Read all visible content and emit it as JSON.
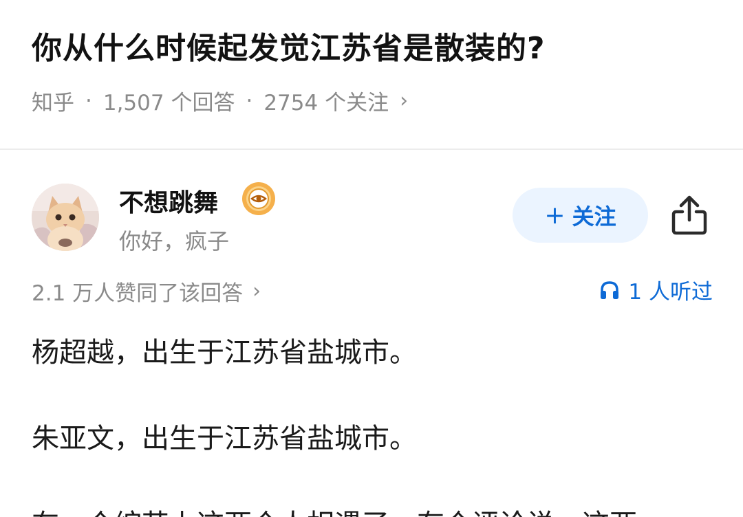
{
  "question": {
    "title": "你从什么时候起发觉江苏省是散装的?",
    "source": "知乎",
    "answers": "1,507 个回答",
    "followers": "2754 个关注",
    "separator": "·",
    "chevron": "›"
  },
  "answer": {
    "author_name": "不想跳舞",
    "author_signature": "你好，疯子",
    "follow_label": "关注",
    "follow_prefix": "+",
    "votes_label": "2.1 万人赞同了该回答",
    "votes_chevron": "›",
    "listen_label": "1 人听过",
    "paragraphs": [
      "杨超越，出生于江苏省盐城市。",
      "朱亚文，出生于江苏省盐城市。",
      "在一个综艺上这两个人相遇了，有个评论说，这两"
    ]
  },
  "colors": {
    "accent": "#0d6ad6",
    "follow_bg": "#ebf4ff",
    "muted_text": "#8a8a8a",
    "badge": "#f5b04b"
  },
  "icons": {
    "badge": "eye-badge-icon",
    "share": "share-icon",
    "listen": "headphones-icon"
  }
}
